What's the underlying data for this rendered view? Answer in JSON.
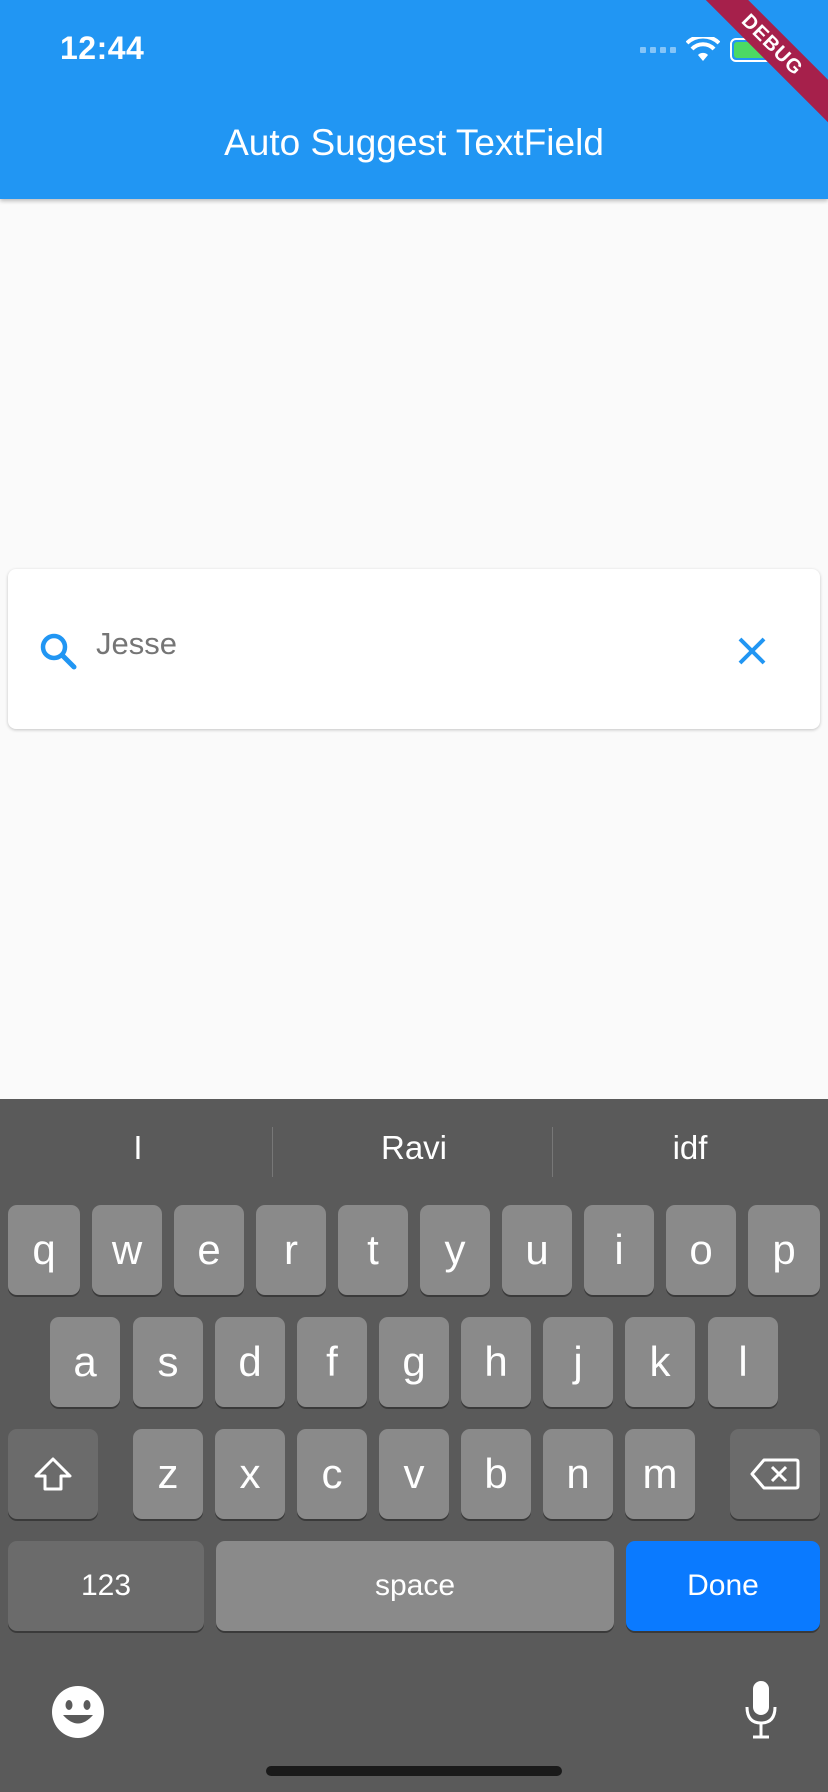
{
  "status_bar": {
    "time": "12:44"
  },
  "app_bar": {
    "title": "Auto Suggest TextField",
    "debug_label": "DEBUG"
  },
  "search": {
    "value": "Jesse"
  },
  "keyboard": {
    "suggestions": [
      "I",
      "Ravi",
      "idf"
    ],
    "row1": [
      "q",
      "w",
      "e",
      "r",
      "t",
      "y",
      "u",
      "i",
      "o",
      "p"
    ],
    "row2": [
      "a",
      "s",
      "d",
      "f",
      "g",
      "h",
      "j",
      "k",
      "l"
    ],
    "row3": [
      "z",
      "x",
      "c",
      "v",
      "b",
      "n",
      "m"
    ],
    "numbers_label": "123",
    "space_label": "space",
    "done_label": "Done"
  },
  "colors": {
    "primary": "#2196f3",
    "done": "#0a7aff",
    "keyboard_bg": "#5a5a5a"
  },
  "icons": [
    "search-icon",
    "close-icon",
    "wifi-icon",
    "battery-icon",
    "shift-icon",
    "backspace-icon",
    "emoji-icon",
    "microphone-icon"
  ]
}
